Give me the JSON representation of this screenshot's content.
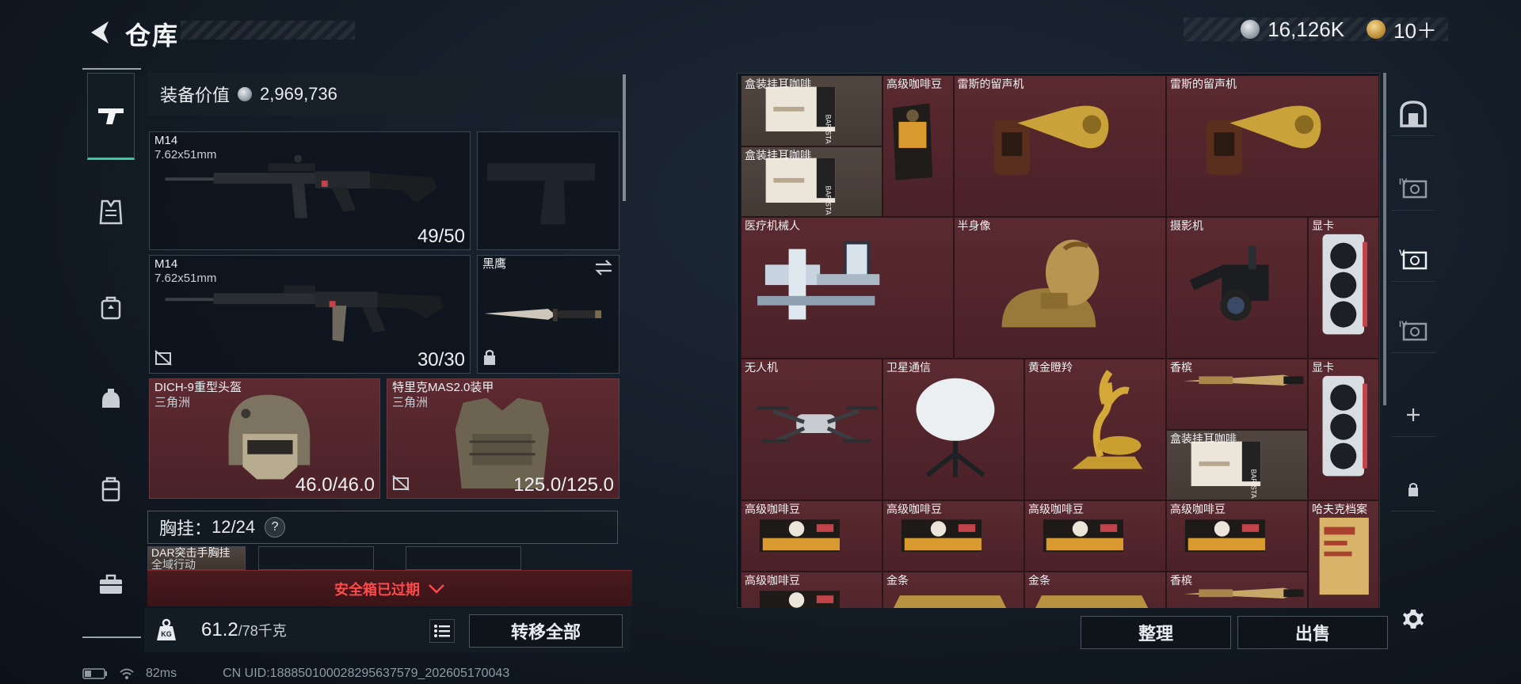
{
  "header": {
    "title": "仓库",
    "silver_amount": "16,126K",
    "gold_amount": "10＋"
  },
  "nav": {
    "items": [
      "firearm-icon",
      "armor-vest-icon",
      "backpack-icon",
      "helmet-bag-icon",
      "case-icon",
      "toolbox-icon"
    ]
  },
  "equipment": {
    "value_label": "装备价值",
    "value": "2,969,736",
    "primary1": {
      "name": "M14",
      "caliber": "7.62x51mm",
      "ammo": "49/50"
    },
    "primary2": {
      "name": "M14",
      "caliber": "7.62x51mm",
      "ammo": "30/30"
    },
    "melee": {
      "name": "黑鹰"
    },
    "helmet": {
      "name": "DICH-9重型头盔",
      "map": "三角洲",
      "durability": "46.0/46.0"
    },
    "armor": {
      "name": "特里克MAS2.0装甲",
      "map": "三角洲",
      "durability": "125.0/125.0"
    },
    "chest_rig": {
      "label": "胸挂：",
      "capacity": "12/24",
      "help": "?",
      "item_name": "DAR突击手胸挂",
      "item_sub": "全域行动"
    },
    "safebox_text": "安全箱已过期"
  },
  "weight": {
    "current": "61.2",
    "max": "/78千克"
  },
  "transfer_all": "转移全部",
  "status": {
    "ping": "82ms",
    "uid": "CN UID:188850100028295637579_202605170043"
  },
  "stash": {
    "items": [
      {
        "name": "盒装挂耳咖啡",
        "type": "coffee-box"
      },
      {
        "name": "盒装挂耳咖啡",
        "type": "coffee-box"
      },
      {
        "name": "高级咖啡豆",
        "type": "coffee-bag"
      },
      {
        "name": "雷斯的留声机",
        "type": "gramophone"
      },
      {
        "name": "雷斯的留声机",
        "type": "gramophone"
      },
      {
        "name": "医疗机械人",
        "type": "med-robot"
      },
      {
        "name": "半身像",
        "type": "bust"
      },
      {
        "name": "摄影机",
        "type": "camera"
      },
      {
        "name": "显卡",
        "type": "gpu"
      },
      {
        "name": "无人机",
        "type": "drone"
      },
      {
        "name": "卫星通信",
        "type": "satellite"
      },
      {
        "name": "黄金瞪羚",
        "type": "gazelle"
      },
      {
        "name": "香槟",
        "type": "champagne"
      },
      {
        "name": "显卡",
        "type": "gpu"
      },
      {
        "name": "盒装挂耳咖啡",
        "type": "coffee-box"
      },
      {
        "name": "高级咖啡豆",
        "type": "coffee-tin"
      },
      {
        "name": "高级咖啡豆",
        "type": "coffee-tin"
      },
      {
        "name": "高级咖啡豆",
        "type": "coffee-tin"
      },
      {
        "name": "高级咖啡豆",
        "type": "coffee-tin"
      },
      {
        "name": "哈夫克档案",
        "type": "dossier"
      },
      {
        "name": "高级咖啡豆",
        "type": "coffee-tin"
      },
      {
        "name": "金条",
        "type": "gold-bar"
      },
      {
        "name": "金条",
        "type": "gold-bar"
      },
      {
        "name": "香槟",
        "type": "champagne"
      }
    ],
    "side_tabs": [
      "vault-icon",
      "stash-iv-icon",
      "stash-v-icon",
      "stash-iv-icon",
      "add-icon",
      "lock-icon"
    ],
    "side_tab_texts": [
      "IV",
      "V",
      "IV"
    ],
    "tidy_label": "整理",
    "sell_label": "出售"
  },
  "colors": {
    "accent": "#39c9a2",
    "item_bg": "#5a2a30",
    "alert": "#ff4a4a"
  }
}
